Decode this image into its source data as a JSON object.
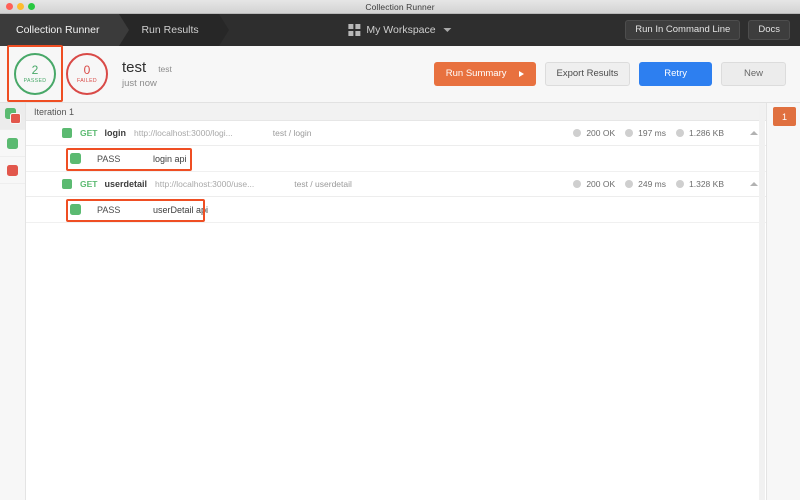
{
  "window": {
    "title": "Collection Runner",
    "traffic_lights": [
      "close-red",
      "minimize-yellow",
      "zoom-green"
    ]
  },
  "navbar": {
    "tabs": [
      {
        "label": "Collection Runner",
        "active": true
      },
      {
        "label": "Run Results",
        "active": false
      }
    ],
    "workspace": {
      "label": "My Workspace",
      "icon": "grid-icon",
      "caret": "chevron-down-icon"
    },
    "actions": [
      {
        "label": "Run In Command Line"
      },
      {
        "label": "Docs"
      }
    ]
  },
  "summary": {
    "passed": {
      "count": "2",
      "label": "PASSED",
      "color": "#48a868",
      "highlighted": true
    },
    "failed": {
      "count": "0",
      "label": "FAILED",
      "color": "#d94a47",
      "highlighted": false
    },
    "run_name": "test",
    "collection_name": "test",
    "timestamp": "just now",
    "buttons": {
      "run_summary": "Run Summary",
      "export_results": "Export Results",
      "retry": "Retry",
      "new": "New"
    },
    "accent_orange": "#e8713f",
    "accent_blue": "#2d7ff0",
    "highlight_color": "#ef4e23"
  },
  "rail": {
    "items": [
      {
        "name": "filter-all",
        "icon": "green-red-squares-icon",
        "selected": true
      },
      {
        "name": "filter-passed",
        "icon": "green-square-icon",
        "selected": false
      },
      {
        "name": "filter-failed",
        "icon": "red-square-icon",
        "selected": false
      }
    ]
  },
  "results": {
    "iteration_label": "Iteration 1",
    "requests": [
      {
        "method": "GET",
        "name": "login",
        "url": "http://localhost:3000/logi...",
        "path": "test / login",
        "status": "200 OK",
        "time": "197 ms",
        "size": "1.286 KB",
        "collapse_icon": "chevron-up-icon",
        "tests": [
          {
            "status": "PASS",
            "name": "login api",
            "highlighted": true
          }
        ]
      },
      {
        "method": "GET",
        "name": "userdetail",
        "url": "http://localhost:3000/use...",
        "path": "test / userdetail",
        "status": "200 OK",
        "time": "249 ms",
        "size": "1.328 KB",
        "collapse_icon": "chevron-up-icon",
        "tests": [
          {
            "status": "PASS",
            "name": "userDetail api",
            "highlighted": true
          }
        ]
      }
    ]
  },
  "right_panel": {
    "iterations": [
      {
        "label": "1",
        "selected": true
      }
    ]
  }
}
